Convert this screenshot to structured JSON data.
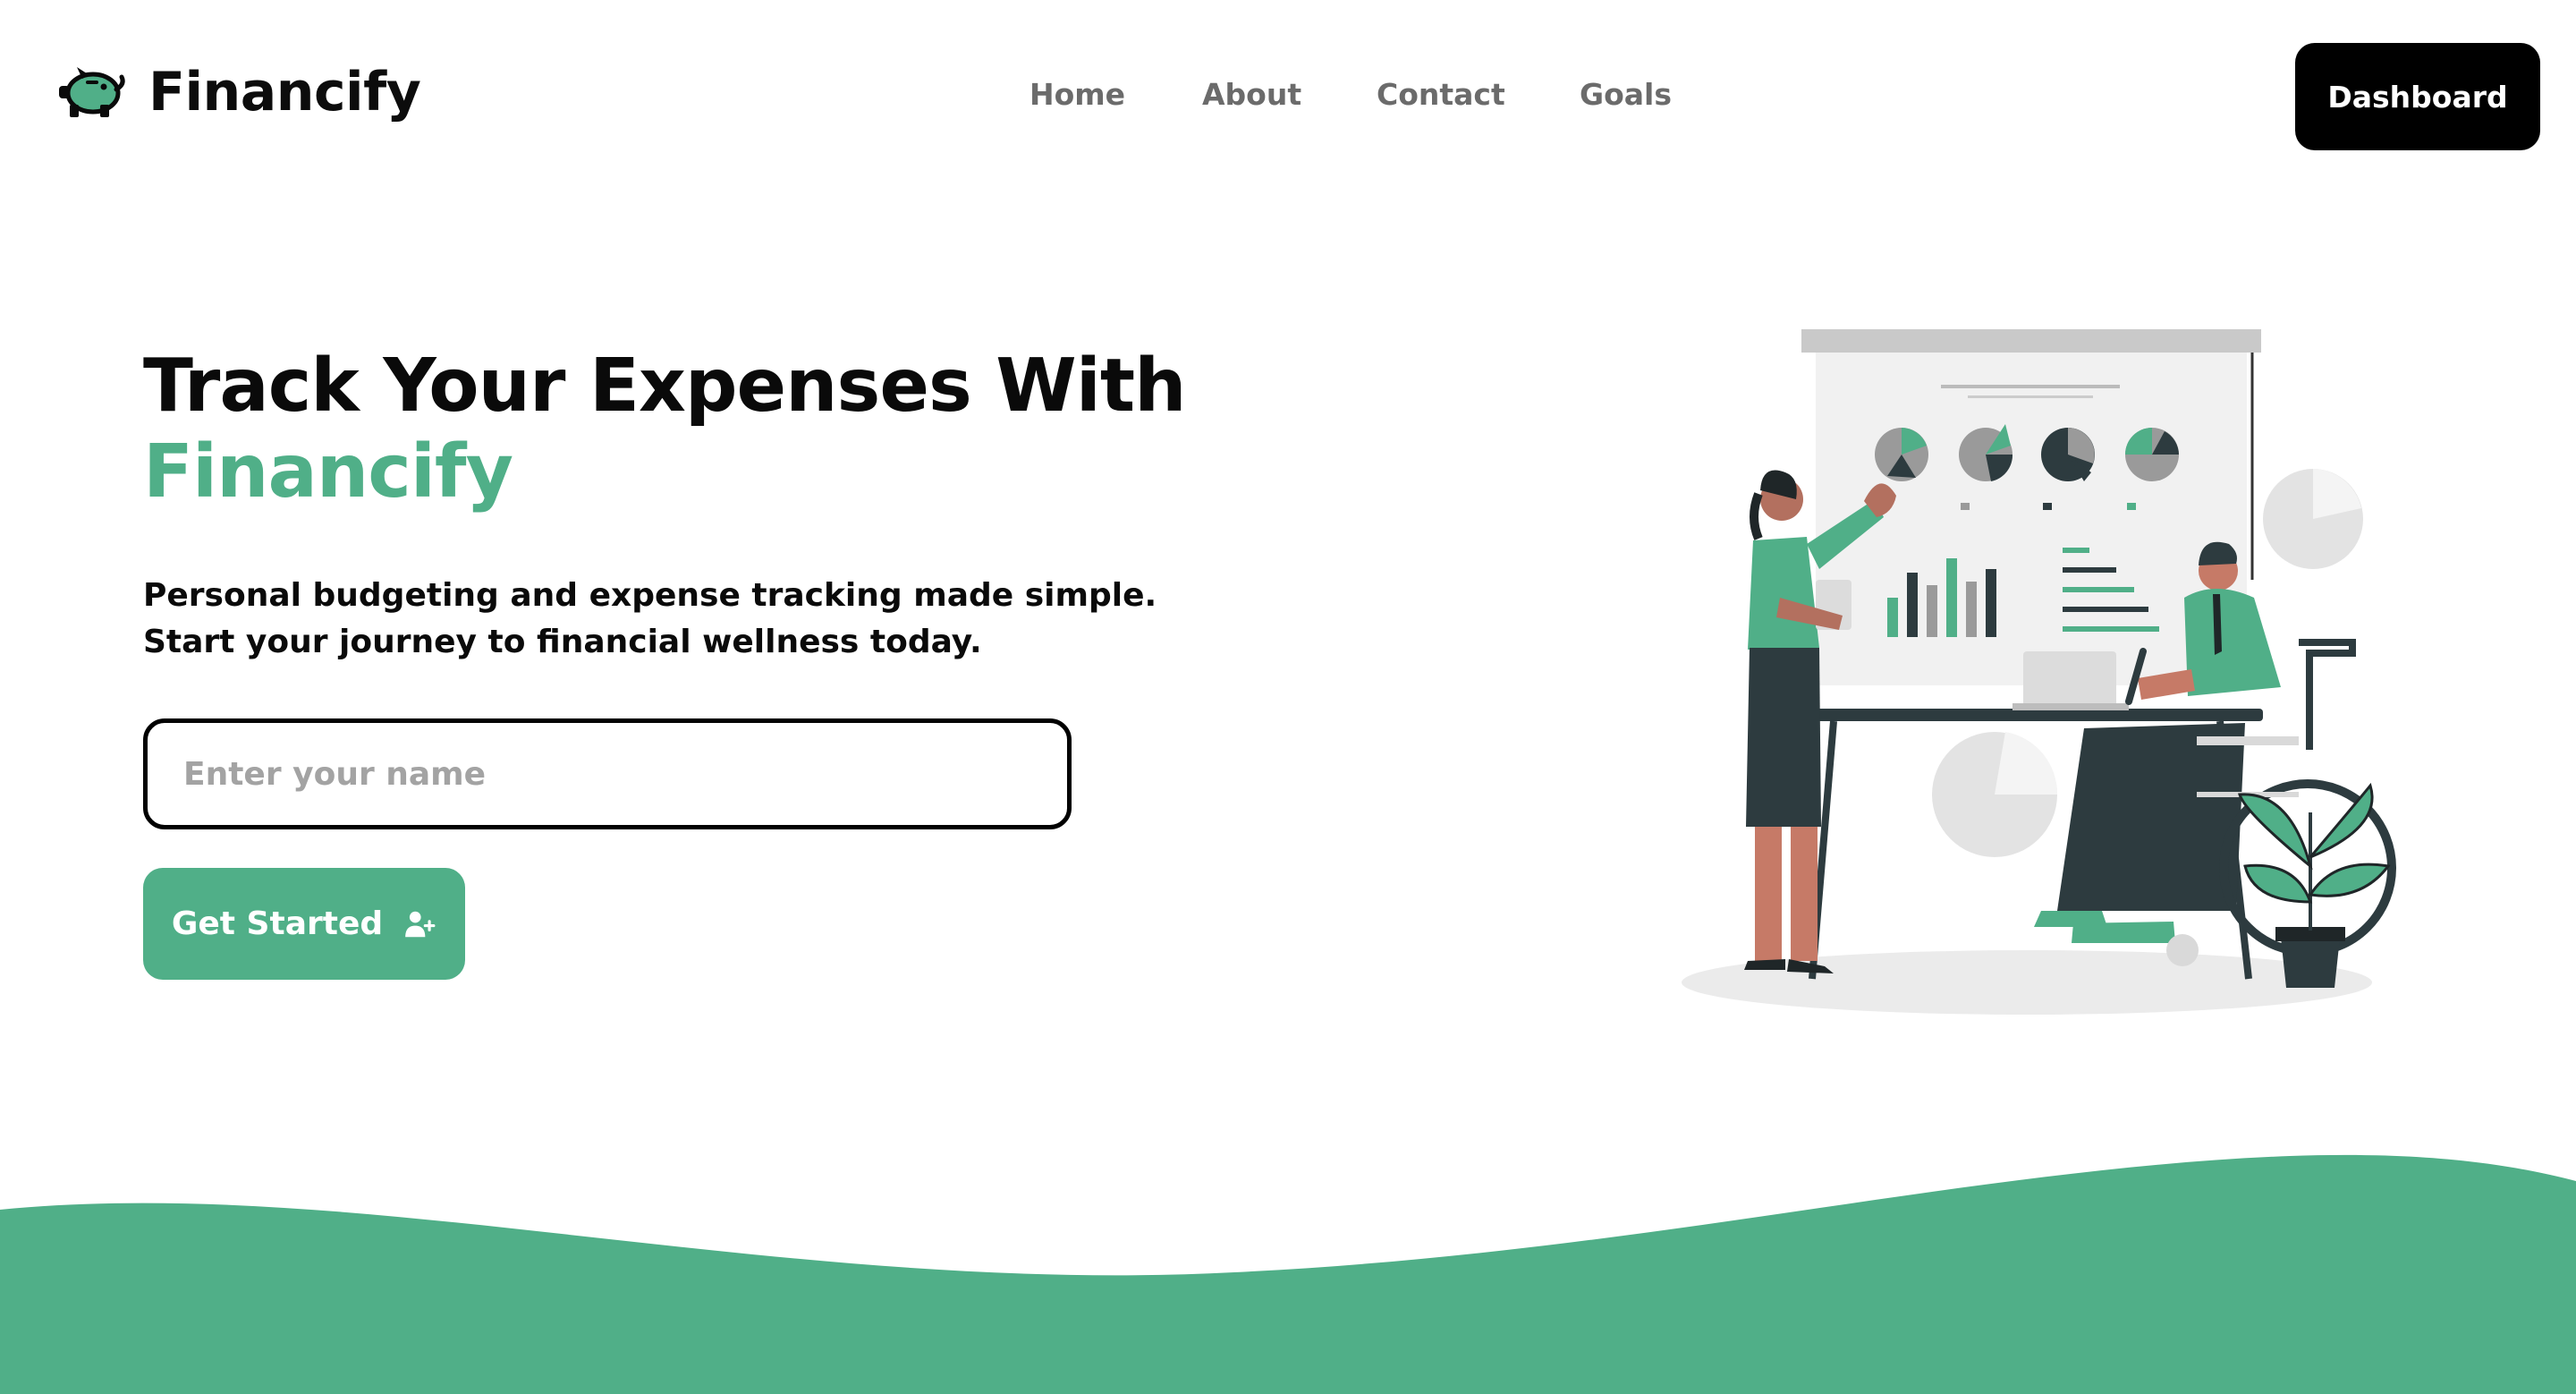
{
  "brand": {
    "name": "Financify",
    "icon": "piggy-bank-icon"
  },
  "nav": {
    "links": [
      {
        "label": "Home"
      },
      {
        "label": "About"
      },
      {
        "label": "Contact"
      },
      {
        "label": "Goals"
      }
    ],
    "dashboard_label": "Dashboard"
  },
  "hero": {
    "title_line1": "Track Your Expenses With",
    "title_accent": "Financify",
    "subtitle_line1": "Personal budgeting and expense tracking made simple.",
    "subtitle_line2": "Start your journey to financial wellness today.",
    "input_placeholder": "Enter your name",
    "input_value": "",
    "cta_label": "Get Started",
    "cta_icon": "user-plus-icon"
  },
  "colors": {
    "accent": "#50af88",
    "dark": "#000000",
    "nav_text": "#6b6b6b",
    "placeholder": "#a3a3a3"
  }
}
